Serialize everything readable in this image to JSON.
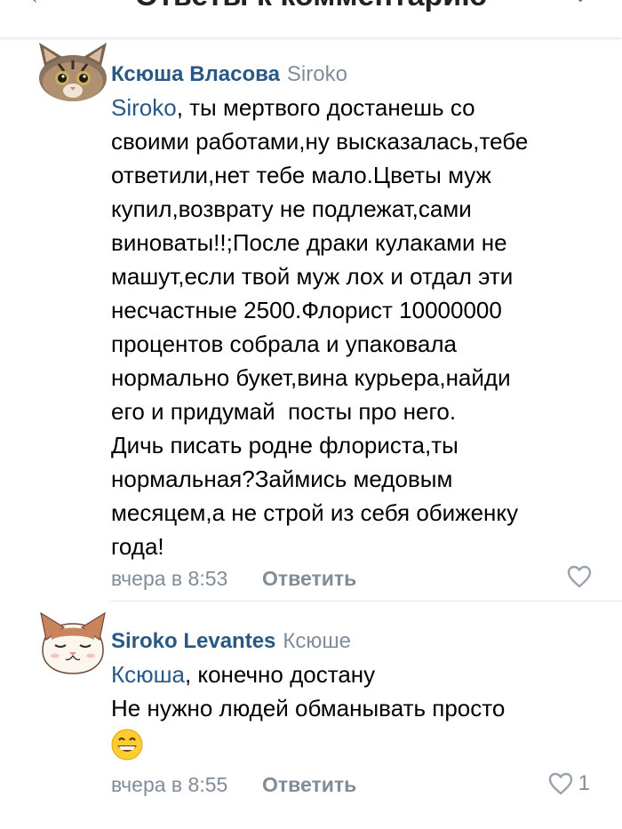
{
  "header": {
    "title": "Ответы к комментарию"
  },
  "comments": [
    {
      "author": "Ксюша Власова",
      "reply_to": "Siroko",
      "avatar": "cat-avatar-tabby",
      "text_lines": [
        [
          "Siroko",
          ", ты мертвого достанешь со"
        ],
        "своими работами,ну высказалась,тебе",
        "ответили,нет тебе мало.Цветы муж",
        "купил,возврату не подлежат,сами",
        "виноваты!!;После драки кулаками не",
        "машут,если твой муж лох и отдал эти",
        "несчастные 2500.Флорист 10000000",
        "процентов собрала и упаковала",
        "нормально букет,вина курьера,найди",
        "его и придумай  посты про него.",
        "Дичь писать родне флориста,ты",
        "нормальная?Займись медовым",
        "месяцем,а не строй из себя обиженку",
        "года!"
      ],
      "time": "вчера в 8:53",
      "reply_label": "Ответить",
      "likes": ""
    },
    {
      "author": "Siroko Levantes",
      "reply_to": "Ксюше",
      "avatar": "cat-avatar-drawn",
      "mention": "Ксюша",
      "line1_rest": ", конечно достану",
      "line2": "Не нужно людей обманывать просто",
      "emoji": "grinning-face-emoji",
      "time": "вчера в 8:55",
      "reply_label": "Ответить",
      "likes": "1"
    }
  ],
  "colors": {
    "author": "#2a5885",
    "secondary": "#818c99",
    "text": "#000000"
  }
}
